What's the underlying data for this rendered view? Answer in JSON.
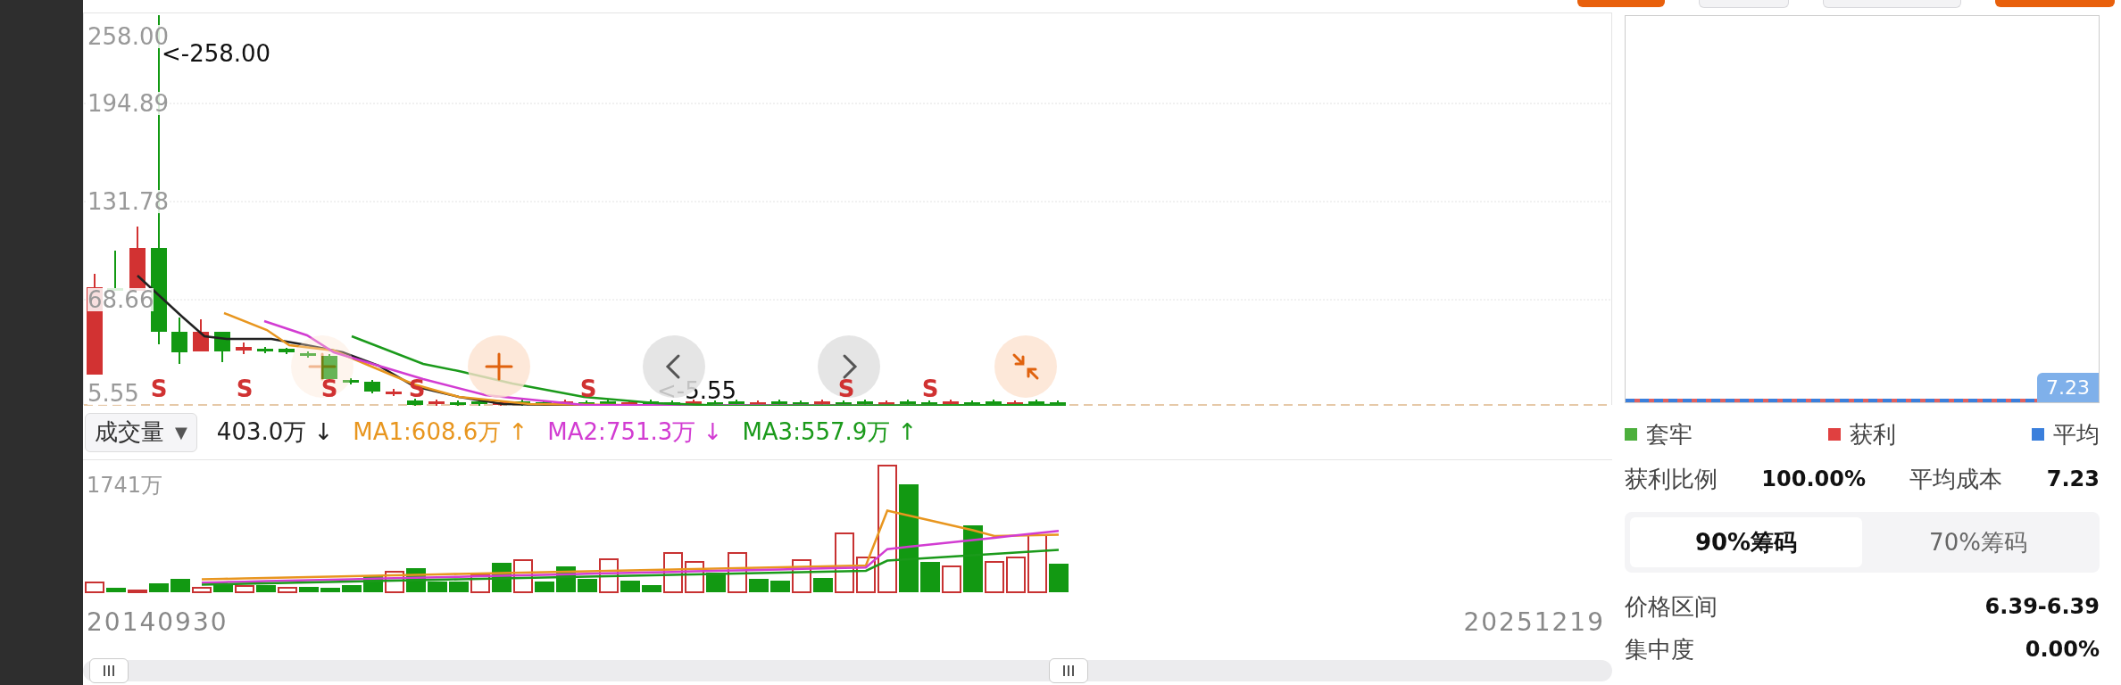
{
  "top_buttons": [
    {
      "kind": "primary"
    },
    {
      "kind": "plain"
    },
    {
      "kind": "plain"
    },
    {
      "kind": "primary"
    }
  ],
  "price_chart": {
    "axis_labels": [
      "258.00",
      "194.89",
      "131.78",
      "68.66",
      "5.55"
    ],
    "high_label": "<-258.00",
    "low_label": "<-5.55",
    "signals": [
      "S",
      "S",
      "S",
      "S",
      "S",
      "S",
      "S"
    ],
    "overlay_buttons": [
      {
        "kind": "plus",
        "faded": true
      },
      {
        "kind": "plus",
        "faded": false
      },
      {
        "kind": "prev",
        "faded": false
      },
      {
        "kind": "next",
        "faded": false
      },
      {
        "kind": "shrink",
        "faded": false
      }
    ]
  },
  "volume": {
    "selector": {
      "label": "成交量",
      "caret": "▼"
    },
    "readings": [
      {
        "text": "403.0万",
        "arrow": "↓",
        "color": "#222222"
      },
      {
        "text": "MA1:608.6万",
        "arrow": "↑",
        "color": "#e8961f"
      },
      {
        "text": "MA2:751.3万",
        "arrow": "↓",
        "color": "#d23cd2"
      },
      {
        "text": "MA3:557.9万",
        "arrow": "↑",
        "color": "#1b9a1b"
      }
    ],
    "axis_label": "1741万"
  },
  "date_range": {
    "start": "20140930",
    "end": "20251219"
  },
  "chips": {
    "price_badge": "7.23",
    "legend": [
      {
        "label": "套牢",
        "color": "#4caf3c"
      },
      {
        "label": "获利",
        "color": "#e04040"
      },
      {
        "label": "平均",
        "color": "#3a7fdc"
      }
    ],
    "stats": [
      {
        "label": "获利比例",
        "value": "100.00%"
      },
      {
        "label": "平均成本",
        "value": "7.23"
      }
    ],
    "tabs": [
      {
        "label": "90%筹码",
        "selected": true
      },
      {
        "label": "70%筹码",
        "selected": false
      }
    ],
    "rows": [
      {
        "label": "价格区间",
        "value": "6.39-6.39"
      },
      {
        "label": "集中度",
        "value": "0.00%"
      }
    ]
  }
}
